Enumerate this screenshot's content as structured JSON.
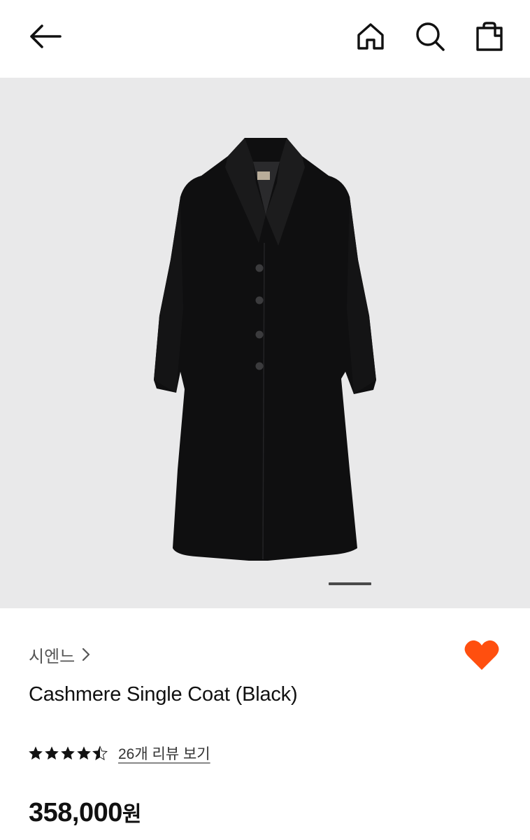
{
  "header": {
    "icons": [
      "back-arrow-icon",
      "home-icon",
      "search-icon",
      "shopping-bag-icon"
    ]
  },
  "gallery": {
    "total_pages": 1,
    "current_page": 1
  },
  "product": {
    "brand": "시엔느",
    "name": "Cashmere Single Coat (Black)",
    "rating": 4.5,
    "rating_max": 5,
    "review_link": "26개 리뷰 보기",
    "price": "358,000",
    "currency": "원",
    "liked": true
  },
  "colors": {
    "accent_like": "#ff4f0f",
    "text_primary": "#111111",
    "text_secondary": "#555555",
    "image_background": "#e9e9ea"
  }
}
